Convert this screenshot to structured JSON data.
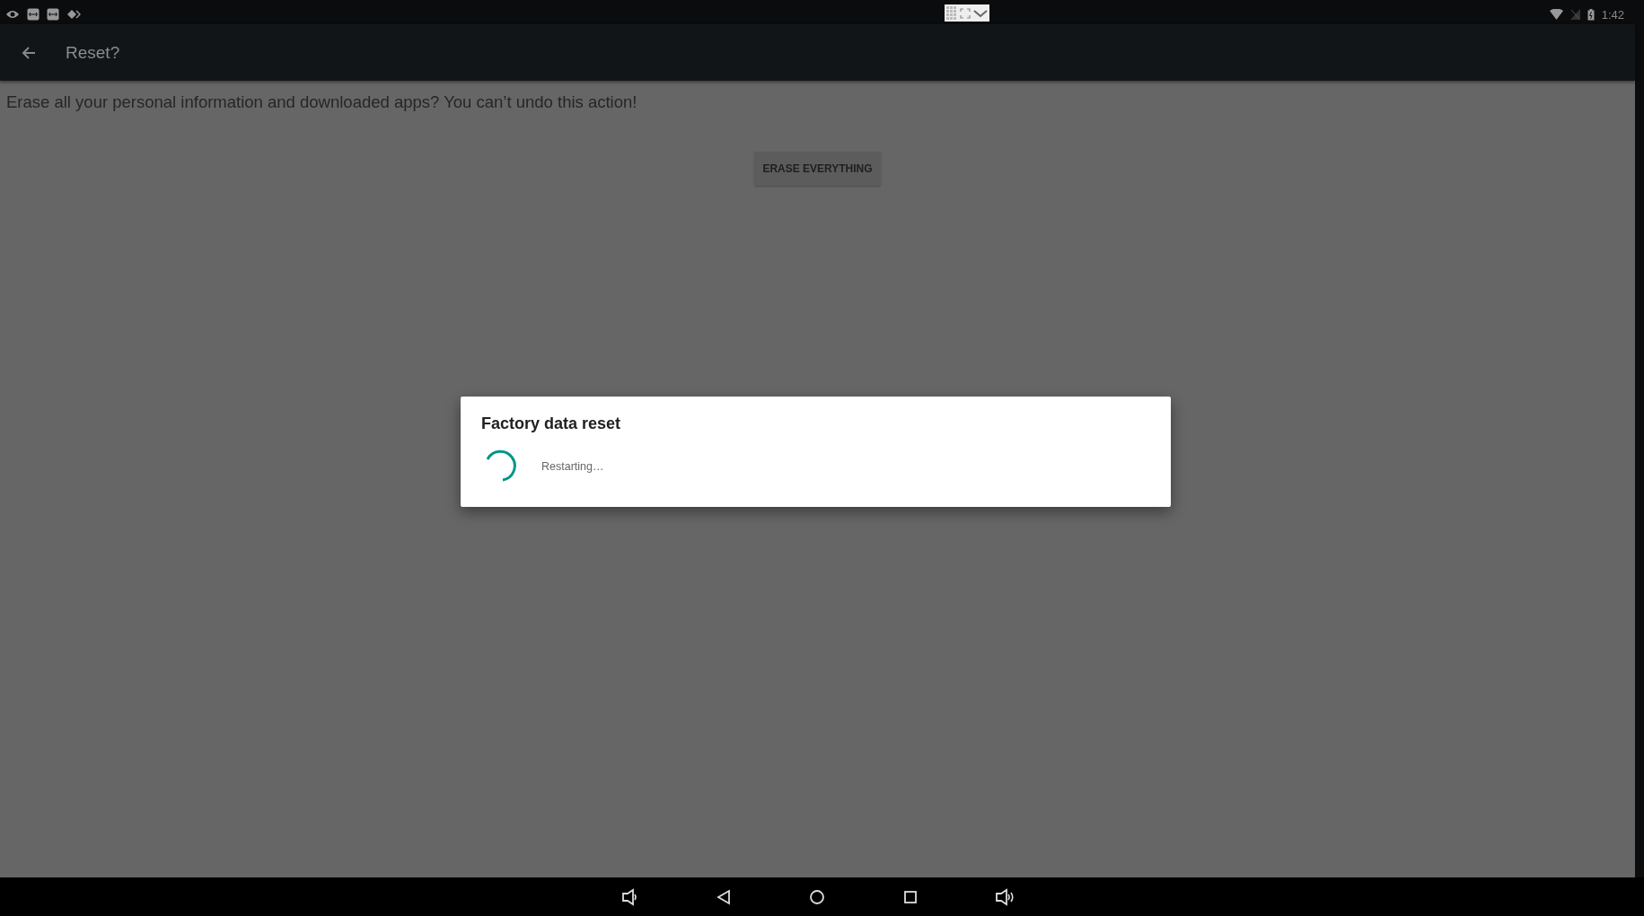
{
  "status_bar": {
    "time": "1:42"
  },
  "app_bar": {
    "title": "Reset?"
  },
  "message": "Erase all your personal information and downloaded apps? You can’t undo this action!",
  "button": "ERASE EVERYTHING",
  "dialog": {
    "title": "Factory data reset",
    "message": "Restarting…"
  }
}
